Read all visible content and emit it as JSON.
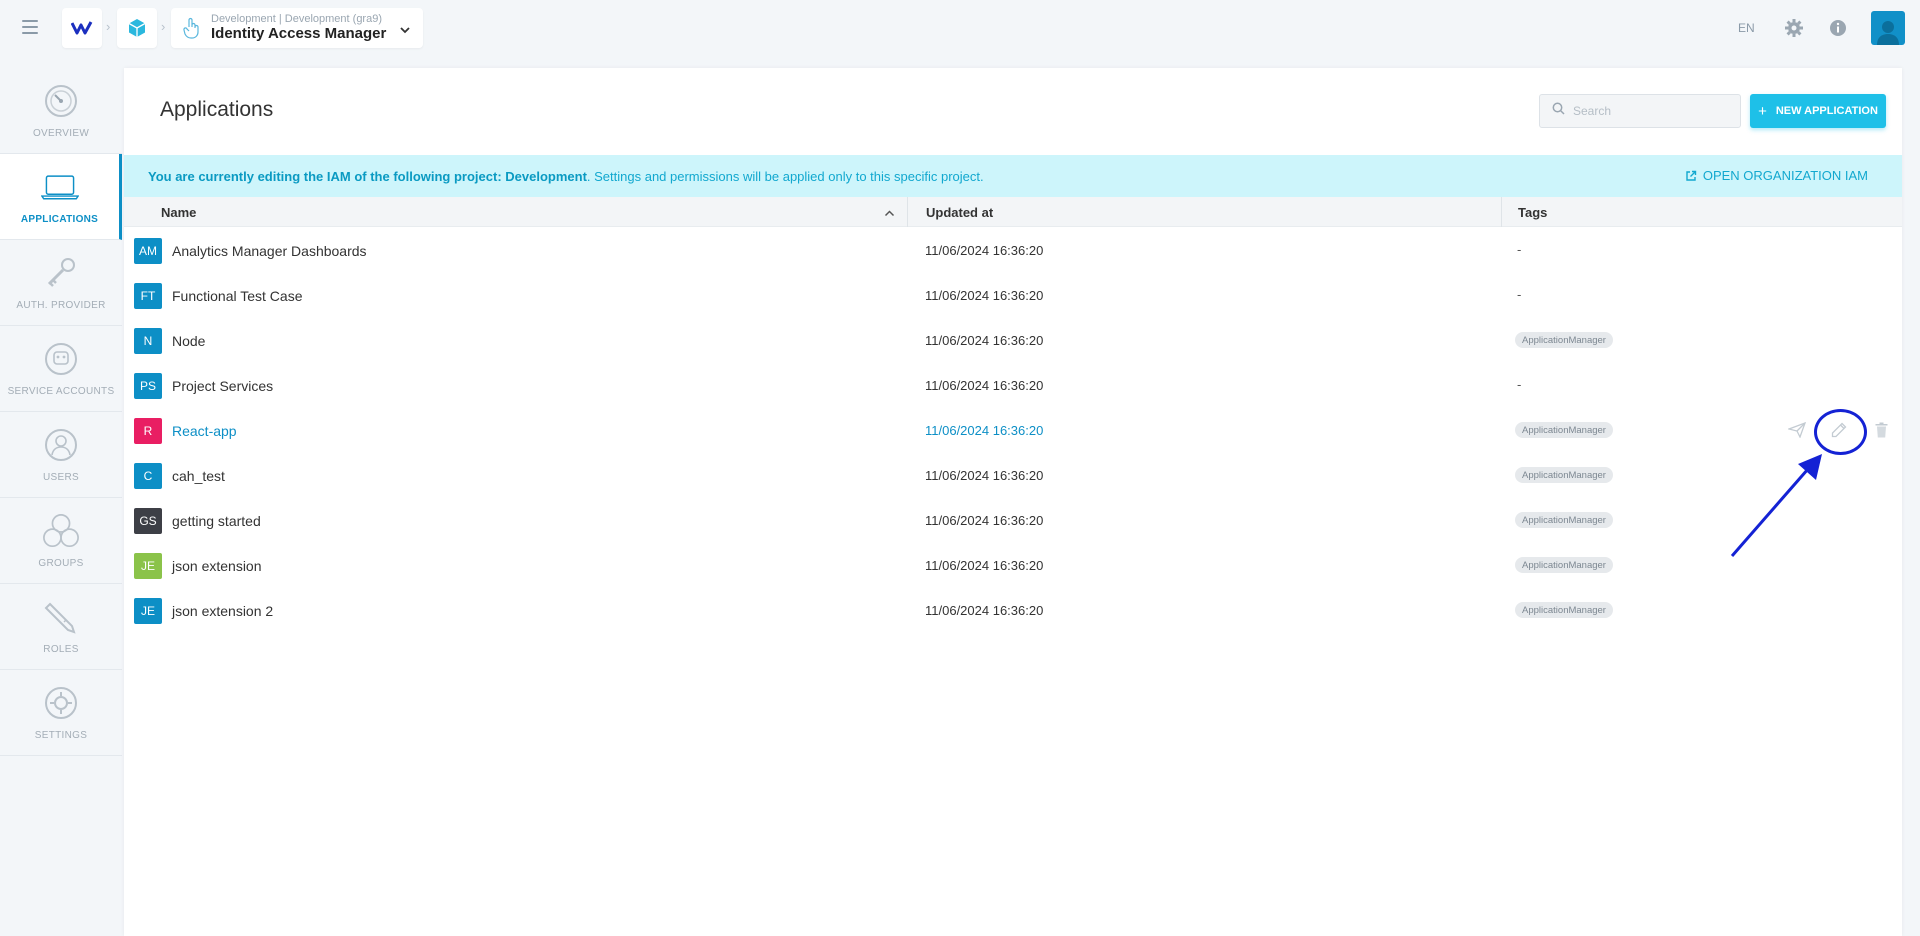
{
  "topbar": {
    "breadcrumb_context": "Development | Development (gra9)",
    "app_name": "Identity Access Manager",
    "language": "EN"
  },
  "sidebar": {
    "items": [
      {
        "label": "OVERVIEW",
        "icon": "gauge-icon",
        "active": false
      },
      {
        "label": "APPLICATIONS",
        "icon": "laptop-icon",
        "active": true
      },
      {
        "label": "AUTH. PROVIDER",
        "icon": "key-icon",
        "active": false
      },
      {
        "label": "SERVICE ACCOUNTS",
        "icon": "robot-icon",
        "active": false
      },
      {
        "label": "USERS",
        "icon": "user-icon",
        "active": false
      },
      {
        "label": "GROUPS",
        "icon": "users-group-icon",
        "active": false
      },
      {
        "label": "ROLES",
        "icon": "pencil-icon",
        "active": false
      },
      {
        "label": "SETTINGS",
        "icon": "gear-icon",
        "active": false
      }
    ]
  },
  "main": {
    "title": "Applications",
    "search_placeholder": "Search",
    "new_button_label": "NEW APPLICATION",
    "banner": {
      "bold_text": "You are currently editing the IAM of the following project: Development",
      "text": ". Settings and permissions will be applied only to this specific project.",
      "link_label": "OPEN ORGANIZATION IAM"
    },
    "table": {
      "columns": [
        "Name",
        "Updated at",
        "Tags"
      ],
      "rows": [
        {
          "initials": "AM",
          "name": "Analytics Manager Dashboards",
          "updated": "11/06/2024 16:36:20",
          "tags": "-",
          "color": "#0d8fc6"
        },
        {
          "initials": "FT",
          "name": "Functional Test Case",
          "updated": "11/06/2024 16:36:20",
          "tags": "-",
          "color": "#0d8fc6"
        },
        {
          "initials": "N",
          "name": "Node",
          "updated": "11/06/2024 16:36:20",
          "tags": "ApplicationManager",
          "color": "#0d8fc6"
        },
        {
          "initials": "PS",
          "name": "Project Services",
          "updated": "11/06/2024 16:36:20",
          "tags": "-",
          "color": "#0d8fc6"
        },
        {
          "initials": "R",
          "name": "React-app",
          "updated": "11/06/2024 16:36:20",
          "tags": "ApplicationManager",
          "color": "#e91e63"
        },
        {
          "initials": "C",
          "name": "cah_test",
          "updated": "11/06/2024 16:36:20",
          "tags": "ApplicationManager",
          "color": "#0d8fc6"
        },
        {
          "initials": "GS",
          "name": "getting started",
          "updated": "11/06/2024 16:36:20",
          "tags": "ApplicationManager",
          "color": "#3d3f46"
        },
        {
          "initials": "JE",
          "name": "json extension",
          "updated": "11/06/2024 16:36:20",
          "tags": "ApplicationManager",
          "color": "#8bc34a"
        },
        {
          "initials": "JE",
          "name": "json extension 2",
          "updated": "11/06/2024 16:36:20",
          "tags": "ApplicationManager",
          "color": "#0d8fc6"
        }
      ]
    }
  },
  "colors": {
    "accent": "#0d8fc6",
    "button": "#1ec0e8",
    "banner_bg": "#cdf5fb",
    "annotation": "#1422d4"
  }
}
